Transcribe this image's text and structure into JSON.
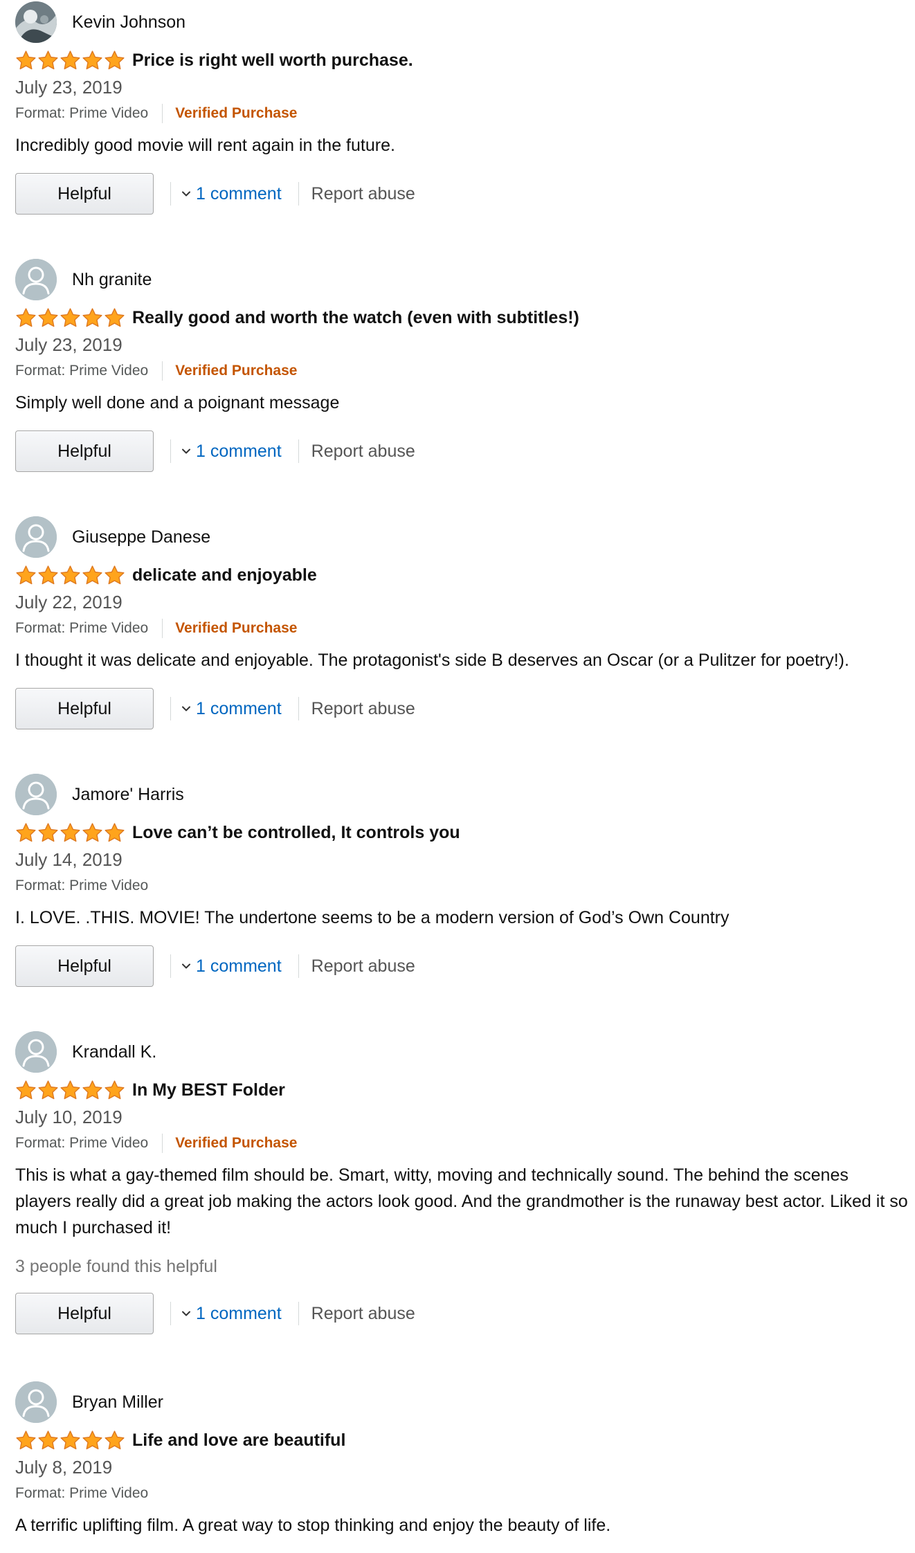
{
  "helpful_label": "Helpful",
  "report_label": "Report abuse",
  "format_prefix": "Format: ",
  "colors": {
    "star_fill": "#ffa41c",
    "star_stroke": "#de7921",
    "link": "#0066c0",
    "verified": "#c45500",
    "avatar_bg": "#b3c1c7"
  },
  "reviews": [
    {
      "name": "Kevin Johnson",
      "avatar": "photo",
      "rating": 5,
      "title": "Price is right well worth purchase.",
      "date": "July 23, 2019",
      "format": "Format: Prime Video",
      "verified": "Verified Purchase",
      "body": "Incredibly good movie will rent again in the future.",
      "helpful_count": "",
      "comment": "1 comment"
    },
    {
      "name": "Nh granite",
      "avatar": "default",
      "rating": 5,
      "title": "Really good and worth the watch (even with subtitles!)",
      "date": "July 23, 2019",
      "format": "Format: Prime Video",
      "verified": "Verified Purchase",
      "body": "Simply well done and a poignant message",
      "helpful_count": "",
      "comment": "1 comment"
    },
    {
      "name": "Giuseppe Danese",
      "avatar": "default",
      "rating": 5,
      "title": "delicate and enjoyable",
      "date": "July 22, 2019",
      "format": "Format: Prime Video",
      "verified": "Verified Purchase",
      "body": "I thought it was delicate and enjoyable. The protagonist's side B deserves an Oscar (or a Pulitzer for poetry!).",
      "helpful_count": "",
      "comment": "1 comment"
    },
    {
      "name": "Jamore' Harris",
      "avatar": "default",
      "rating": 5,
      "title": "Love can’t be controlled, It controls you",
      "date": "July 14, 2019",
      "format": "Format: Prime Video",
      "verified": "",
      "body": "I. LOVE. .THIS. MOVIE! The undertone seems to be a modern version of God’s Own Country",
      "helpful_count": "",
      "comment": "1 comment"
    },
    {
      "name": "Krandall K.",
      "avatar": "default",
      "rating": 5,
      "title": "In My BEST Folder",
      "date": "July 10, 2019",
      "format": "Format: Prime Video",
      "verified": "Verified Purchase",
      "body": "This is what a gay-themed film should be. Smart, witty, moving and technically sound. The behind the scenes players really did a great job making the actors look good. And the grandmother is the runaway best actor. Liked it so much I purchased it!",
      "helpful_count": "3 people found this helpful",
      "comment": "1 comment"
    },
    {
      "name": "Bryan Miller",
      "avatar": "default",
      "rating": 5,
      "title": "Life and love are beautiful",
      "date": "July 8, 2019",
      "format": "Format: Prime Video",
      "verified": "",
      "body": "A terrific uplifting film. A great way to stop thinking and enjoy the beauty of life.",
      "helpful_count": "",
      "comment": ""
    }
  ]
}
